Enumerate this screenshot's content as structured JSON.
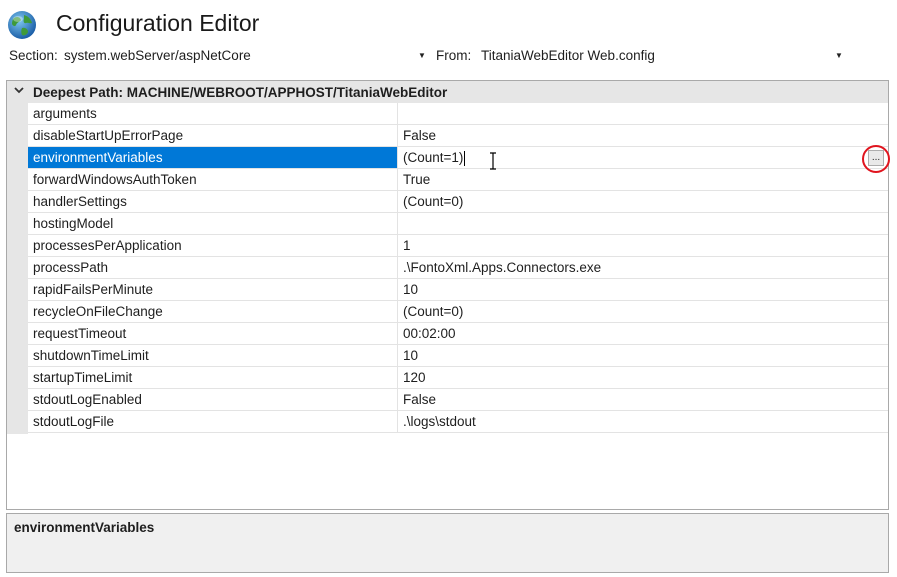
{
  "app": {
    "title": "Configuration Editor"
  },
  "section": {
    "label": "Section:",
    "value": "system.webServer/aspNetCore"
  },
  "from": {
    "label": "From:",
    "value": "TitaniaWebEditor Web.config"
  },
  "grid": {
    "header": "Deepest Path: MACHINE/WEBROOT/APPHOST/TitaniaWebEditor",
    "selected_index": 2,
    "rows": [
      {
        "name": "arguments",
        "value": ""
      },
      {
        "name": "disableStartUpErrorPage",
        "value": "False"
      },
      {
        "name": "environmentVariables",
        "value": "(Count=1)"
      },
      {
        "name": "forwardWindowsAuthToken",
        "value": "True"
      },
      {
        "name": "handlerSettings",
        "value": "(Count=0)"
      },
      {
        "name": "hostingModel",
        "value": ""
      },
      {
        "name": "processesPerApplication",
        "value": "1"
      },
      {
        "name": "processPath",
        "value": ".\\FontoXml.Apps.Connectors.exe"
      },
      {
        "name": "rapidFailsPerMinute",
        "value": "10"
      },
      {
        "name": "recycleOnFileChange",
        "value": "(Count=0)"
      },
      {
        "name": "requestTimeout",
        "value": "00:02:00"
      },
      {
        "name": "shutdownTimeLimit",
        "value": "10"
      },
      {
        "name": "startupTimeLimit",
        "value": "120"
      },
      {
        "name": "stdoutLogEnabled",
        "value": "False"
      },
      {
        "name": "stdoutLogFile",
        "value": ".\\logs\\stdout"
      }
    ],
    "ellipsis_label": "..."
  },
  "description": {
    "title": "environmentVariables"
  },
  "icons": {
    "globe": "globe-icon",
    "chevron": "chevron-down-icon",
    "cursor": "i-beam-cursor-icon"
  },
  "colors": {
    "selection": "#0078d7",
    "highlight_circle": "#e0141e"
  }
}
